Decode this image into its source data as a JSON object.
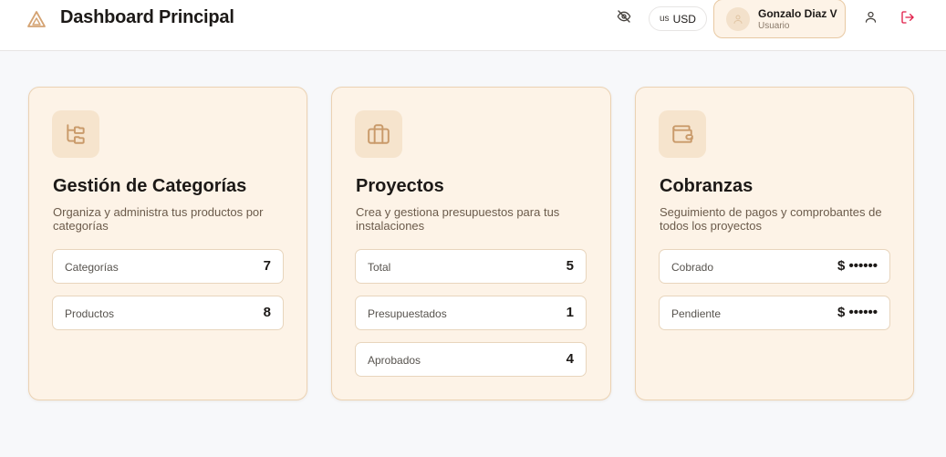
{
  "header": {
    "title": "Dashboard Principal",
    "currency_flag": "us",
    "currency_code": "USD",
    "user_name": "Gonzalo Diaz V",
    "user_role": "Usuario",
    "accent_color": "#d4a373",
    "logout_color": "#e11d48",
    "icons": [
      "logo-triangle-icon",
      "eye-off-icon",
      "user-icon",
      "logout-icon"
    ]
  },
  "cards": [
    {
      "icon": "folder-tree-icon",
      "title": "Gestión de Categorías",
      "description": "Organiza y administra tus productos por categorías",
      "stats": [
        {
          "label": "Categorías",
          "value": "7"
        },
        {
          "label": "Productos",
          "value": "8"
        }
      ]
    },
    {
      "icon": "briefcase-icon",
      "title": "Proyectos",
      "description": "Crea y gestiona presupuestos para tus instalaciones",
      "stats": [
        {
          "label": "Total",
          "value": "5"
        },
        {
          "label": "Presupuestados",
          "value": "1"
        },
        {
          "label": "Aprobados",
          "value": "4"
        }
      ]
    },
    {
      "icon": "wallet-icon",
      "title": "Cobranzas",
      "description": "Seguimiento de pagos y comprobantes de todos los proyectos",
      "stats": [
        {
          "label": "Cobrado",
          "value": "$ ••••••"
        },
        {
          "label": "Pendiente",
          "value": "$ ••••••"
        }
      ]
    }
  ]
}
